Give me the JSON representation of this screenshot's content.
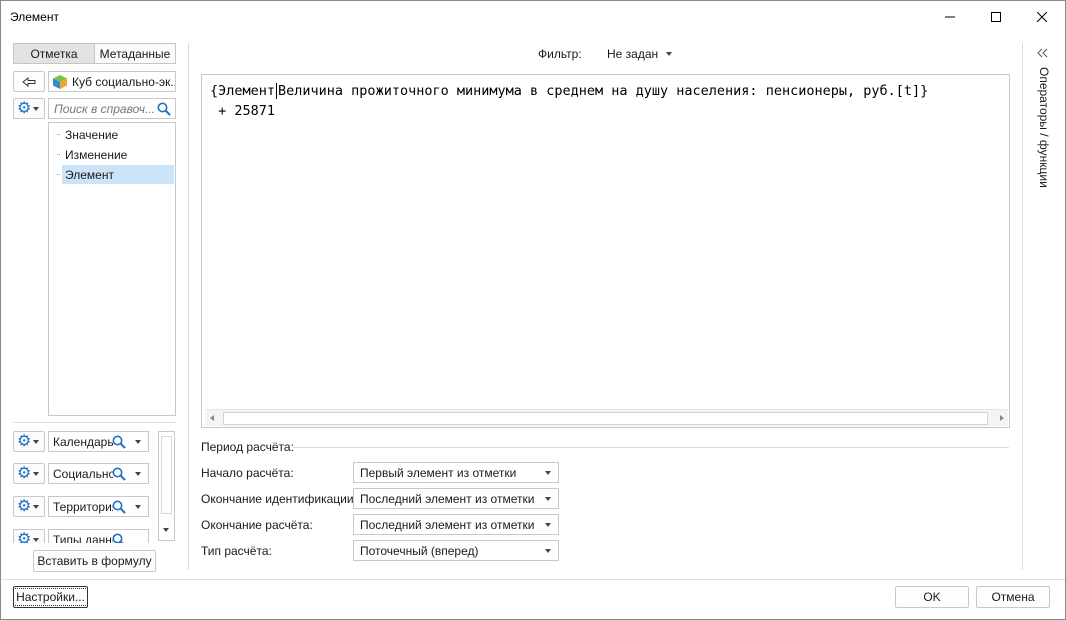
{
  "window": {
    "title": "Элемент"
  },
  "left_panel": {
    "tabs": [
      {
        "label": "Отметка",
        "active": true
      },
      {
        "label": "Метаданные",
        "active": false
      }
    ],
    "source_label": "Куб социально-эк...",
    "search": {
      "placeholder": "Поиск в справоч..."
    },
    "tree_items": [
      {
        "label": "Значение",
        "selected": false
      },
      {
        "label": "Изменение",
        "selected": false
      },
      {
        "label": "Элемент",
        "selected": true
      }
    ],
    "dimensions": [
      {
        "label": "Календарь"
      },
      {
        "label": "Социально"
      },
      {
        "label": "Территория"
      },
      {
        "label": "Типы данны"
      }
    ],
    "insert_button": "Вставить в формулу"
  },
  "filter": {
    "label": "Фильтр:",
    "value": "Не задан"
  },
  "formula": {
    "line1_open": "{Элемент",
    "line1_rest": "Величина прожиточного минимума в среднем на душу населения: пенсионеры, руб.[t]}",
    "line2": " + 25871"
  },
  "period": {
    "section_title": "Период расчёта:",
    "rows": [
      {
        "label": "Начало расчёта:",
        "value": "Первый элемент из отметки"
      },
      {
        "label": "Окончание идентификации:",
        "value": "Последний элемент из отметки"
      },
      {
        "label": "Окончание расчёта:",
        "value": "Последний элемент из отметки"
      },
      {
        "label": "Тип расчёта:",
        "value": "Поточечный (вперед)"
      }
    ]
  },
  "right_panel": {
    "label": "Операторы / функции"
  },
  "footer": {
    "settings_button": "Настройки...",
    "ok_button": "OK",
    "cancel_button": "Отмена"
  },
  "colors": {
    "selection": "#cce4f7",
    "accent_icon": "#1f6fc5",
    "border": "#c8c8c8"
  }
}
